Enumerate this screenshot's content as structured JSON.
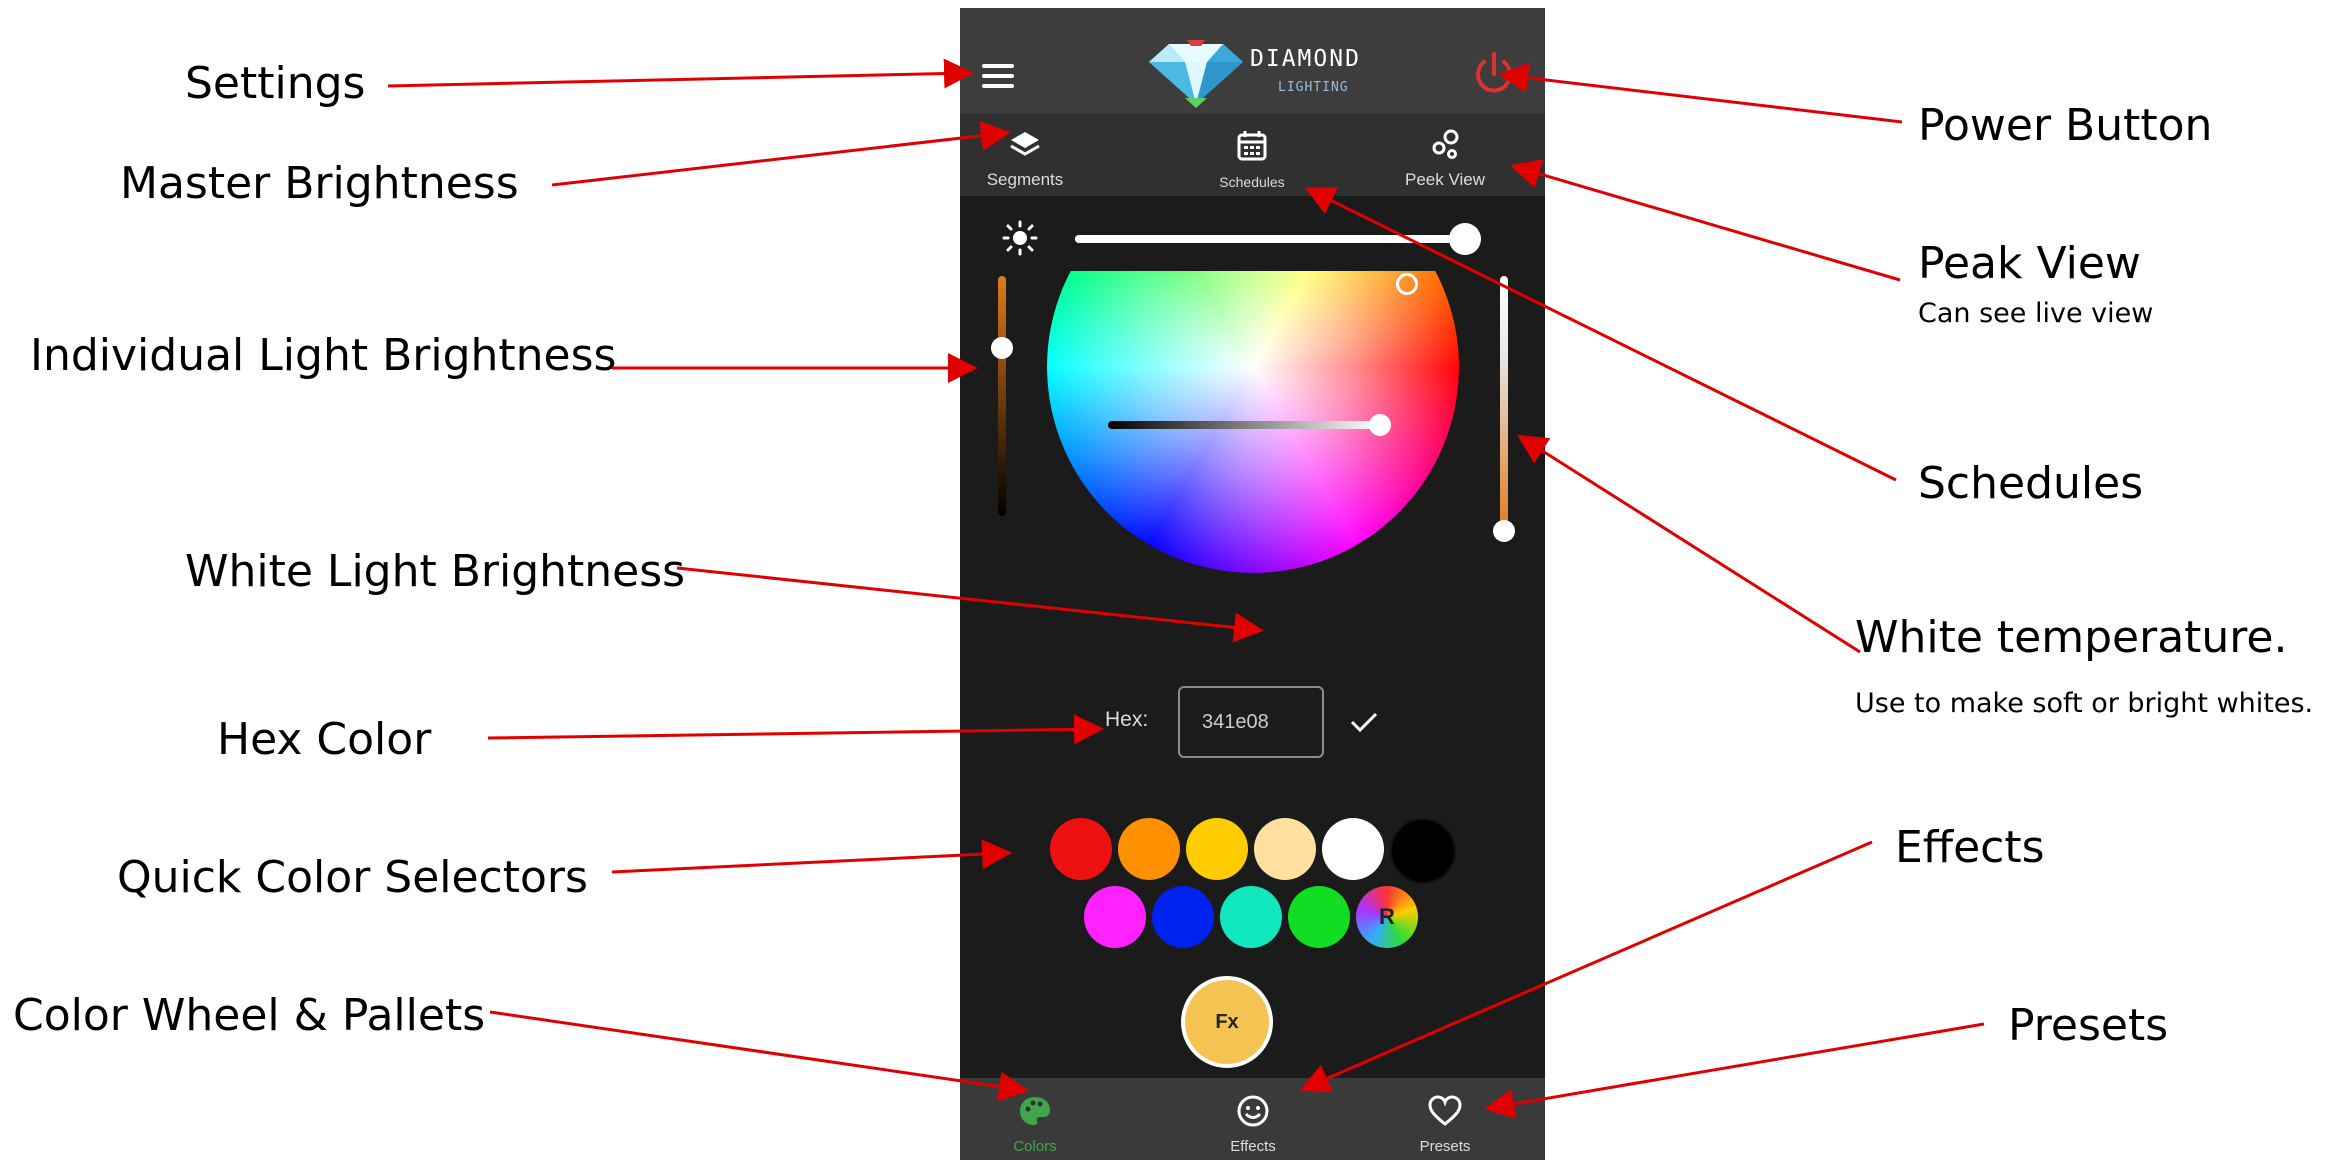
{
  "labels": {
    "settings": "Settings",
    "master_brightness": "Master Brightness",
    "individual_light_brightness": "Individual Light Brightness",
    "white_light_brightness": "White Light Brightness",
    "hex_color": "Hex Color",
    "quick_color_selectors": "Quick Color Selectors",
    "color_wheel_pallets": "Color Wheel & Pallets",
    "power_button": "Power Button",
    "peak_view": "Peak View",
    "peak_view_sub": "Can see live view",
    "schedules": "Schedules",
    "white_temperature": "White temperature.",
    "white_temperature_sub": "Use to make soft or bright whites.",
    "effects": "Effects",
    "presets": "Presets"
  },
  "app": {
    "logo_title": "DIAMOND",
    "logo_subtitle": "LIGHTING",
    "tabs": [
      "Segments",
      "Schedules",
      "Peek View"
    ],
    "hex_label": "Hex:",
    "hex_value": "341e08",
    "fx_label": "Fx",
    "rainbow_label": "R",
    "bottom_tabs": [
      "Colors",
      "Effects",
      "Presets"
    ],
    "master_brightness_level": 1.0,
    "individual_brightness_level": 0.7,
    "white_brightness_level": 1.0,
    "white_temperature_level": 0.0,
    "swatches_row1": [
      "#ee1111",
      "#ff9000",
      "#ffcc00",
      "#ffe0a0",
      "#ffffff",
      "#000000"
    ],
    "swatches_row2": [
      "#ff22ff",
      "#0022ee",
      "#11e8c0",
      "#11dd22",
      "rainbow"
    ],
    "colors": {
      "power": "#e03030",
      "active_tab": "#3fa64a",
      "fx": "#f4c351",
      "slider_warm": "#e07a1a"
    }
  },
  "annotation_color": "#e00000"
}
